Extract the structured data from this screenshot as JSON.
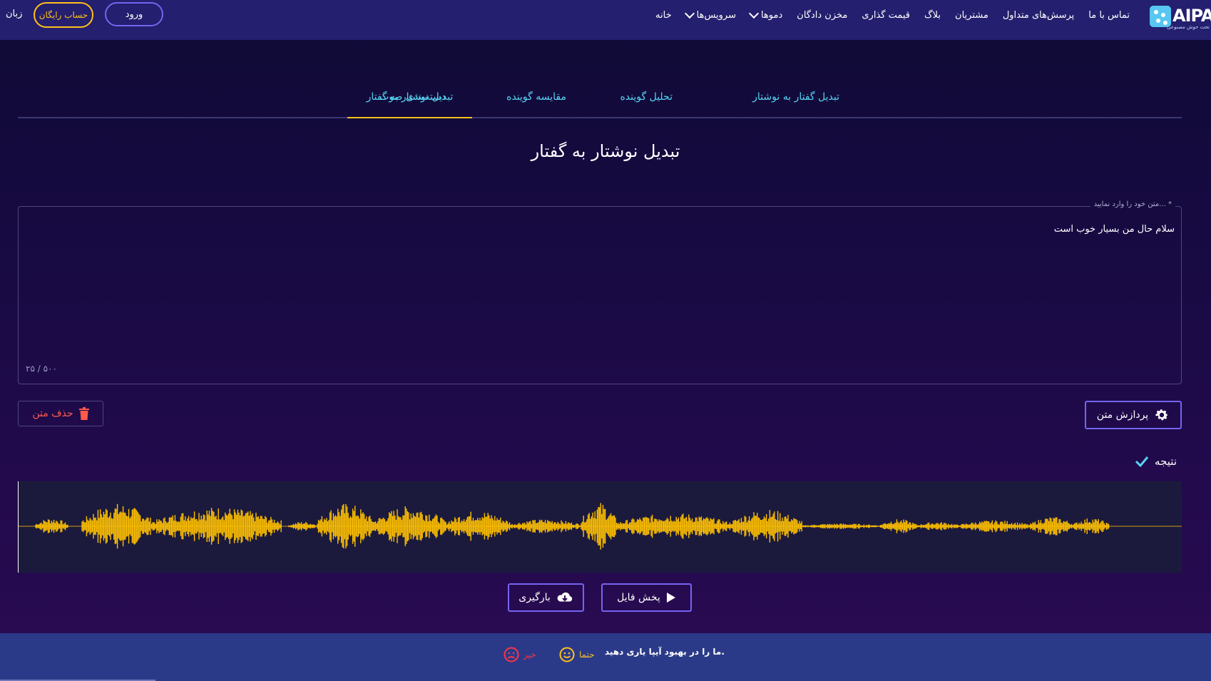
{
  "brand": {
    "name": "AIPA",
    "tagline": "تحت حوش مصنوعی"
  },
  "nav": {
    "items": [
      {
        "label": "خانه"
      },
      {
        "label": "سرویس‌ها",
        "dropdown": true
      },
      {
        "label": "دموها",
        "dropdown": true
      },
      {
        "label": "مخزن دادگان"
      },
      {
        "label": "قیمت گذاری"
      },
      {
        "label": "بلاگ"
      },
      {
        "label": "مشتریان"
      },
      {
        "label": "پرسش‌های متداول"
      },
      {
        "label": "تماس با ما"
      }
    ],
    "login": "ورود",
    "free_account": "حساب رایگان",
    "language": "زبان"
  },
  "tabs": [
    {
      "label": "تبدیل گفتار به نوشتار",
      "active": false
    },
    {
      "label": "تحلیل گوینده",
      "active": false
    },
    {
      "label": "مقایسه گوینده",
      "active": false
    },
    {
      "label": "دسته‌بندی صوت",
      "active": false
    },
    {
      "label": "تبدیل نوشتار به گفتار",
      "active": true
    }
  ],
  "page_title": "تبدیل نوشتار به گفتار",
  "text_input": {
    "label": "متن خود را وارد نمایید... *",
    "value": "سلام حال من بسیار خوب است",
    "counter": "۲۵ / ۵۰۰"
  },
  "actions": {
    "process": "پردازش متن",
    "delete": "حذف متن"
  },
  "result": {
    "label": "نتیجه",
    "play": "پخش فایل",
    "download": "بارگیری"
  },
  "feedback": {
    "question": "ما را در بهبود آیپا یاری دهید.",
    "yes": "حتما",
    "no": "خیر"
  },
  "colors": {
    "nav_bg": "#241f6e",
    "accent_yellow": "#ffc21a",
    "accent_cyan": "#58d3f2",
    "button_border": "#7465f0",
    "danger": "#ff5a4a",
    "waveform": "#ffc000",
    "feedback_bg": "#2b3a88"
  },
  "icons": {
    "process": "gear-icon",
    "delete": "trash-icon",
    "result": "check-icon",
    "play": "play-icon",
    "download": "cloud-download-icon",
    "yes": "smile-icon",
    "no": "frown-icon"
  }
}
